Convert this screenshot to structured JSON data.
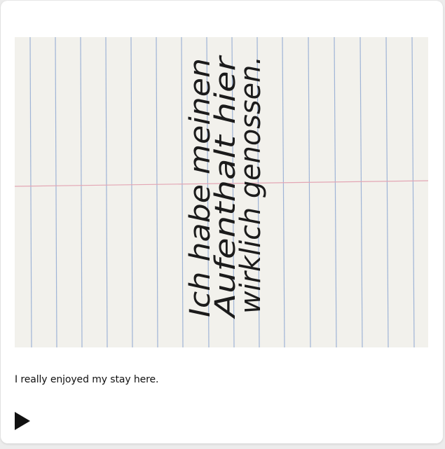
{
  "card": {
    "photo": {
      "handwriting_lines": [
        "Ich habe meinen",
        "Aufenthalt hier",
        "wirklich genossen."
      ],
      "paper_color": "#f2f1ec",
      "ruled_line_color": "#9fb4d6",
      "margin_line_color": "#e3a6b4",
      "ink_color": "#1b1b1b"
    },
    "caption": "I really enjoyed my stay here.",
    "play_icon": "play-icon"
  }
}
